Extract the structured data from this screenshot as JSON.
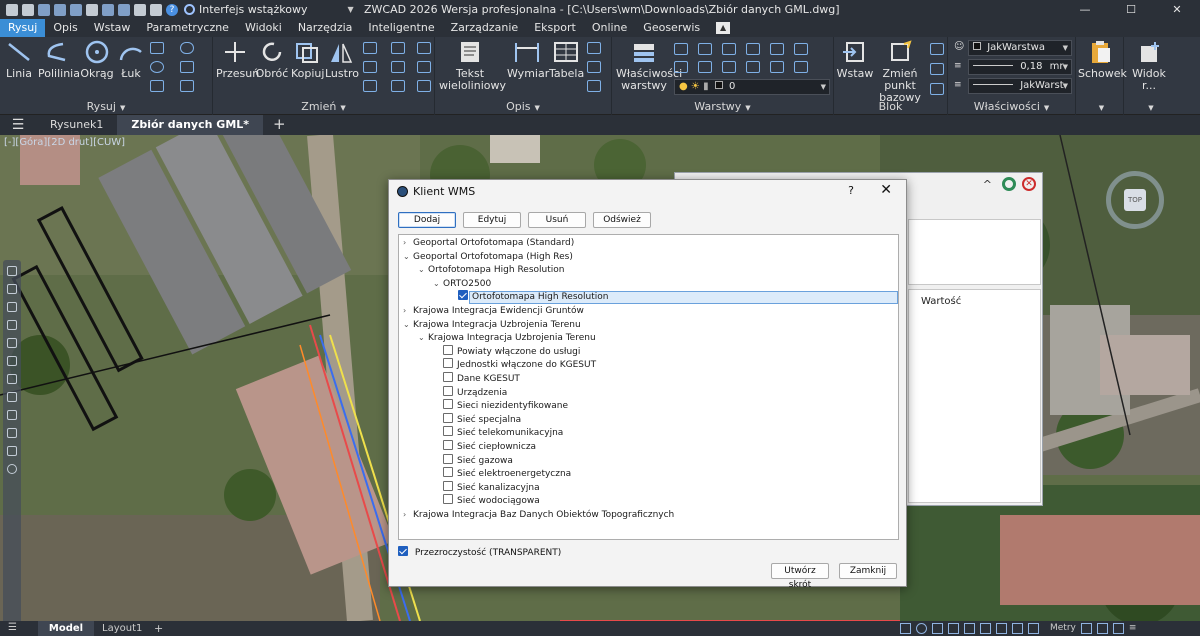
{
  "titlebar": {
    "workspace": "Interfejs wstążkowy",
    "app_title": "ZWCAD 2026 Wersja profesjonalna - [C:\\Users\\wm\\Downloads\\Zbiór danych GML.dwg]",
    "min": "—",
    "max": "☐",
    "close": "✕"
  },
  "menu": [
    "Rysuj",
    "Opis",
    "Wstaw",
    "Parametryczne",
    "Widoki",
    "Narzędzia",
    "Inteligentne",
    "Zarządzanie",
    "Eksport",
    "Online",
    "Geoserwis"
  ],
  "ribbon": {
    "rysuj": {
      "title": "Rysuj",
      "tools": [
        "Linia",
        "Polilinia",
        "Okrąg",
        "Łuk"
      ]
    },
    "zmien": {
      "title": "Zmień",
      "tools": [
        "Przesuń",
        "Obróć",
        "Kopiuj",
        "Lustro"
      ]
    },
    "opis": {
      "title": "Opis",
      "tools": [
        {
          "l1": "Tekst",
          "l2": "wieloliniowy"
        },
        {
          "l1": "Wymiar",
          "l2": ""
        },
        {
          "l1": "Tabela",
          "l2": ""
        }
      ]
    },
    "warstwy": {
      "title": "Warstwy",
      "tool_l1": "Właściwości",
      "tool_l2": "warstwy",
      "layer_value": "0"
    },
    "blok": {
      "title": "Blok",
      "tools": [
        {
          "l1": "Wstaw",
          "l2": ""
        },
        {
          "l1": "Zmień punkt",
          "l2": "bazowy"
        }
      ]
    },
    "wlasciwosci": {
      "title": "Właściwości",
      "color": "JakWarstwa",
      "lineweight": "0,18",
      "lineweight_unit": "mr",
      "linetype": "JakWarst"
    },
    "schowek": {
      "label": "Schowek"
    },
    "widok": {
      "label": "Widok r..."
    }
  },
  "doctabs": [
    "Rysunek1",
    "Zbiór danych GML*"
  ],
  "canvas": {
    "view_label": "[-][Góra][2D drut][CUW]",
    "navcube_top": "TOP"
  },
  "props_panel": {
    "value_header": "Wartość",
    "caret": "^",
    "close": "✕"
  },
  "dialog": {
    "title": "Klient WMS",
    "help": "?",
    "close": "✕",
    "toolbar": [
      "Dodaj",
      "Edytuj",
      "Usuń",
      "Odśwież"
    ],
    "tree": [
      {
        "text": "Geoportal Ortofotomapa (Standard)",
        "arrow": "›",
        "cb": null
      },
      {
        "text": "Geoportal Ortofotomapa (High Res)",
        "arrow": "⌄",
        "cb": null
      },
      {
        "text": "Ortofotomapa High Resolution",
        "arrow": "⌄",
        "cb": null
      },
      {
        "text": "ORTO2500",
        "arrow": "⌄",
        "cb": null
      },
      {
        "text": "Ortofotomapa High Resolution",
        "arrow": "",
        "cb": true
      },
      {
        "text": "Krajowa Integracja Ewidencji Gruntów",
        "arrow": "›",
        "cb": null
      },
      {
        "text": "Krajowa Integracja Uzbrojenia Terenu",
        "arrow": "⌄",
        "cb": null
      },
      {
        "text": "Krajowa Integracja Uzbrojenia Terenu",
        "arrow": "⌄",
        "cb": null
      },
      {
        "text": "Powiaty włączone do usługi",
        "arrow": "",
        "cb": false
      },
      {
        "text": "Jednostki włączone do KGESUT",
        "arrow": "",
        "cb": false
      },
      {
        "text": "Dane KGESUT",
        "arrow": "",
        "cb": false
      },
      {
        "text": "Urządzenia",
        "arrow": "",
        "cb": false
      },
      {
        "text": "Sieci niezidentyfikowane",
        "arrow": "",
        "cb": false
      },
      {
        "text": "Sieć specjalna",
        "arrow": "",
        "cb": false
      },
      {
        "text": "Sieć telekomunikacyjna",
        "arrow": "",
        "cb": false
      },
      {
        "text": "Sieć ciepłownicza",
        "arrow": "",
        "cb": false
      },
      {
        "text": "Sieć gazowa",
        "arrow": "",
        "cb": false
      },
      {
        "text": "Sieć elektroenergetyczna",
        "arrow": "",
        "cb": false
      },
      {
        "text": "Sieć kanalizacyjna",
        "arrow": "",
        "cb": false
      },
      {
        "text": "Sieć wodociągowa",
        "arrow": "",
        "cb": false
      },
      {
        "text": "Krajowa Integracja Baz Danych Obiektów Topograficznych",
        "arrow": "›",
        "cb": null
      }
    ],
    "transparency_label": "Przezroczystość (TRANSPARENT)",
    "transparency_checked": true,
    "footer": [
      "Utwórz skrót",
      "Zamknij"
    ]
  },
  "statusbar": {
    "tabs": [
      "Model",
      "Layout1"
    ],
    "plus": "+",
    "units": "Metry"
  },
  "colors": {
    "accent": "#3b8ed6",
    "ribbon_bg": "#323842",
    "dialog_bg": "#f3f3f3",
    "selection": "#dcebfa"
  }
}
